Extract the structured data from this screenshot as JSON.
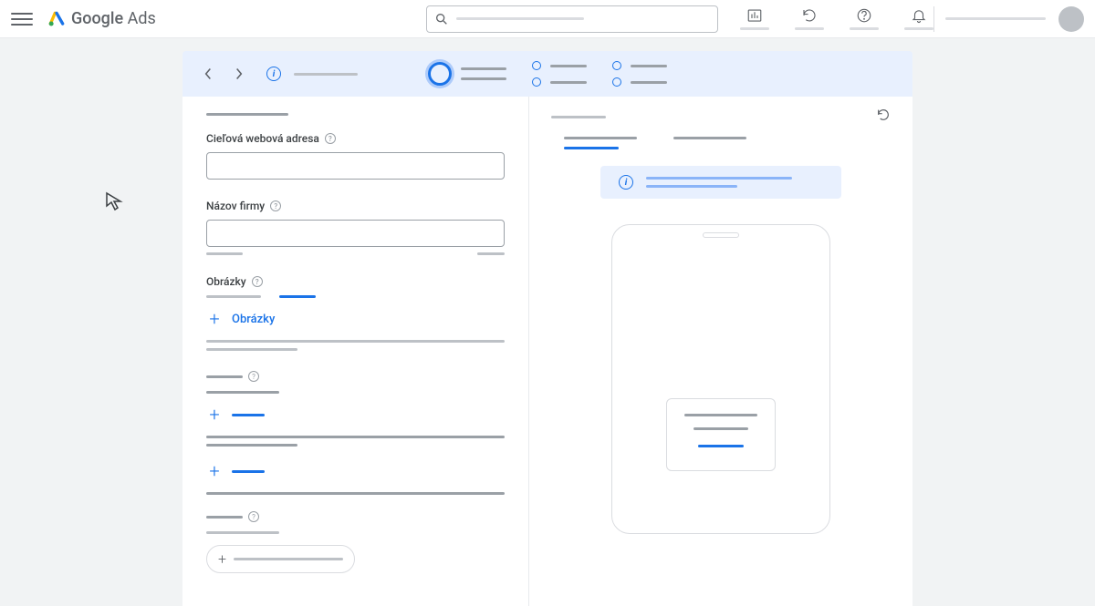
{
  "header": {
    "logo_text_bold": "Google",
    "logo_text_light": "Ads"
  },
  "form": {
    "final_url_label": "Cieľová webová adresa",
    "business_name_label": "Názov firmy",
    "images_section_label": "Obrázky",
    "add_images_label": "Obrázky"
  }
}
